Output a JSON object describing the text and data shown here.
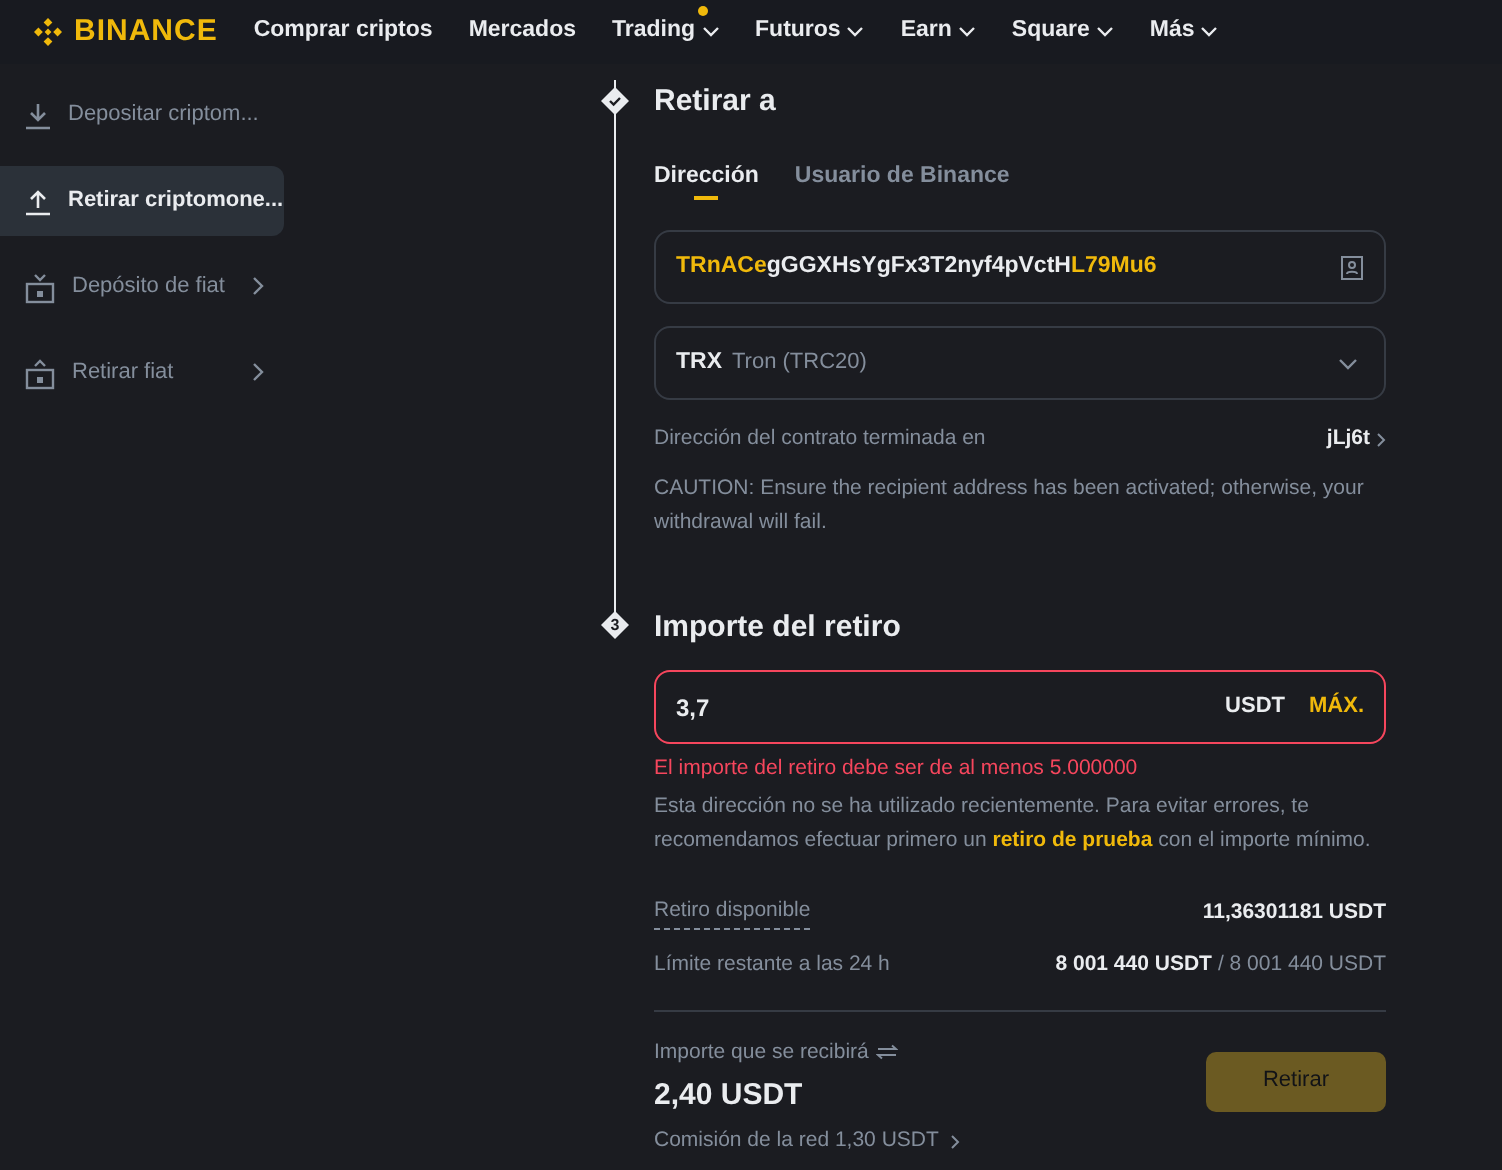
{
  "nav": {
    "logo": "BINANCE",
    "items": [
      {
        "label": "Comprar criptos",
        "has_menu": false,
        "dot": false
      },
      {
        "label": "Mercados",
        "has_menu": false,
        "dot": false
      },
      {
        "label": "Trading",
        "has_menu": true,
        "dot": true
      },
      {
        "label": "Futuros",
        "has_menu": true,
        "dot": false
      },
      {
        "label": "Earn",
        "has_menu": true,
        "dot": false
      },
      {
        "label": "Square",
        "has_menu": true,
        "dot": false
      },
      {
        "label": "Más",
        "has_menu": true,
        "dot": false
      }
    ]
  },
  "sidebar": {
    "items": [
      {
        "label": "Depositar criptom...",
        "selected": false,
        "expandable": false
      },
      {
        "label": "Retirar criptomone...",
        "selected": true,
        "expandable": false
      },
      {
        "label": "Depósito de fiat",
        "selected": false,
        "expandable": true
      },
      {
        "label": "Retirar fiat",
        "selected": false,
        "expandable": true
      }
    ]
  },
  "withdraw_to": {
    "step": {
      "kind": "done"
    },
    "title": "Retirar a",
    "tabs": [
      {
        "label": "Dirección",
        "selected": true
      },
      {
        "label": "Usuario de Binance",
        "selected": false
      }
    ],
    "address": [
      {
        "text": "TRnACe",
        "highlight": true
      },
      {
        "text": "gGGXHsYgFx3T2nyf4pVctH",
        "highlight": false
      },
      {
        "text": "L79Mu6",
        "highlight": true
      }
    ],
    "network": {
      "symbol": "TRX",
      "name": "Tron (TRC20)"
    },
    "contract": {
      "label": "Dirección del contrato terminada en",
      "value": "jLj6t"
    },
    "caution": "CAUTION: Ensure the recipient address has been activated; otherwise, your withdrawal will fail."
  },
  "amount": {
    "step": {
      "kind": "number",
      "label": "3"
    },
    "title": "Importe del retiro",
    "value": "3,7",
    "currency": "USDT",
    "max": "MÁX.",
    "invalid": true,
    "error": "El importe del retiro debe ser de al menos 5.000000",
    "notice": "Esta dirección no se ha utilizado recientemente. Para evitar errores, te recomendamos efectuar primero un **retiro de prueba** con el importe mínimo.",
    "available": {
      "label": "Retiro disponible",
      "value": "11,36301181 USDT"
    },
    "limit": {
      "label": "Límite restante a las 24 h",
      "value": "8 001 440 USDT",
      "total": "/ 8 001 440 USDT"
    },
    "receive": {
      "label": "Importe que se recibirá",
      "value": "2,40 USDT",
      "fee": "Comisión de la red 1,30 USDT"
    },
    "submit": {
      "label": "Retirar",
      "disabled": true
    }
  }
}
